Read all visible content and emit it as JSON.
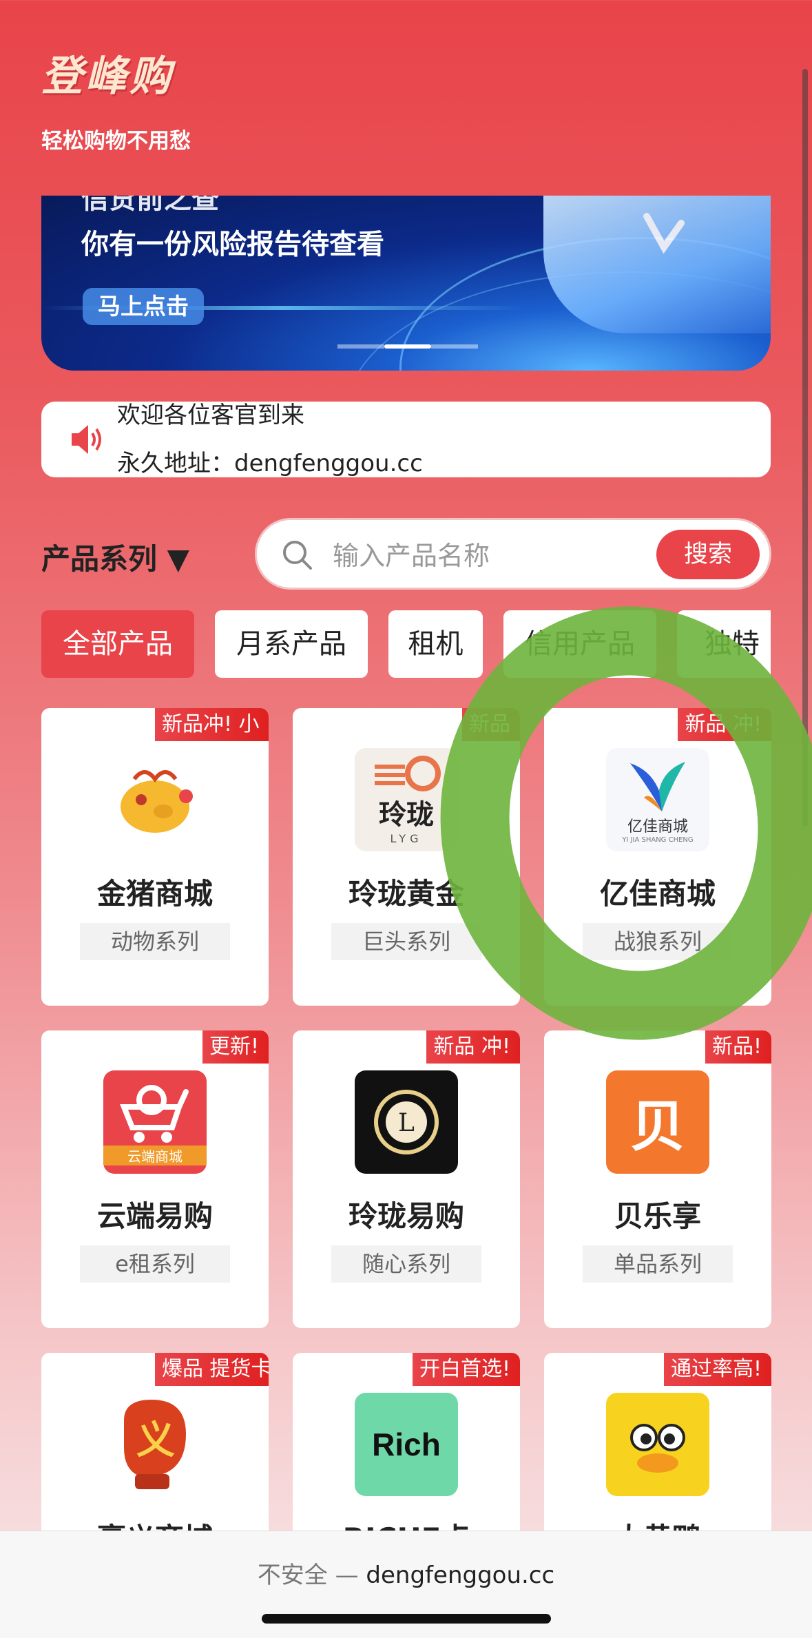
{
  "header": {
    "title": "登峰购",
    "subtitle": "轻松购物不用愁"
  },
  "banner": {
    "title_cut": "信贷前之查",
    "text": "你有一份风险报告待查看",
    "button_label": "马上点击"
  },
  "notice": {
    "lines": [
      "欢迎各位客官到来",
      "永久地址：dengfenggou.cc"
    ]
  },
  "filter": {
    "series_label": "产品系列 ▼",
    "search_placeholder": "输入产品名称",
    "search_button": "搜索"
  },
  "categories": [
    "全部产品",
    "月系产品",
    "租机",
    "信用产品",
    "独特"
  ],
  "products": [
    {
      "badge": "新品冲! 小",
      "name": "金猪商城",
      "tag": "动物系列"
    },
    {
      "badge": "新品",
      "name": "玲珑黄金",
      "tag": "巨头系列"
    },
    {
      "badge": "新品 冲!",
      "name": "亿佳商城",
      "tag": "战狼系列"
    },
    {
      "badge": "更新!",
      "name": "云端易购",
      "tag": "e租系列"
    },
    {
      "badge": "新品 冲!",
      "name": "玲珑易购",
      "tag": "随心系列"
    },
    {
      "badge": "新品!",
      "name": "贝乐享",
      "tag": "单品系列"
    },
    {
      "badge": "爆品 提货卡",
      "name": "豪义商城",
      "tag": ""
    },
    {
      "badge": "开白首选!",
      "name": "RICHE点",
      "tag": ""
    },
    {
      "badge": "通过率高!",
      "name": "大黄鸭",
      "tag": ""
    }
  ],
  "logo_text": {
    "linglong_top": "玲珑",
    "linglong_sub": "LYG",
    "yijia_name": "亿佳商城",
    "yijia_pinyin": "YI JIA SHANG CHENG",
    "yunduan": "云端商城",
    "beile": "贝",
    "haoyi": "义",
    "rich": "Rich"
  },
  "browser": {
    "insecure": "不安全 — ",
    "domain": "dengfenggou.cc"
  },
  "colors": {
    "primary": "#e8444a",
    "ring": "#6eb43c"
  }
}
